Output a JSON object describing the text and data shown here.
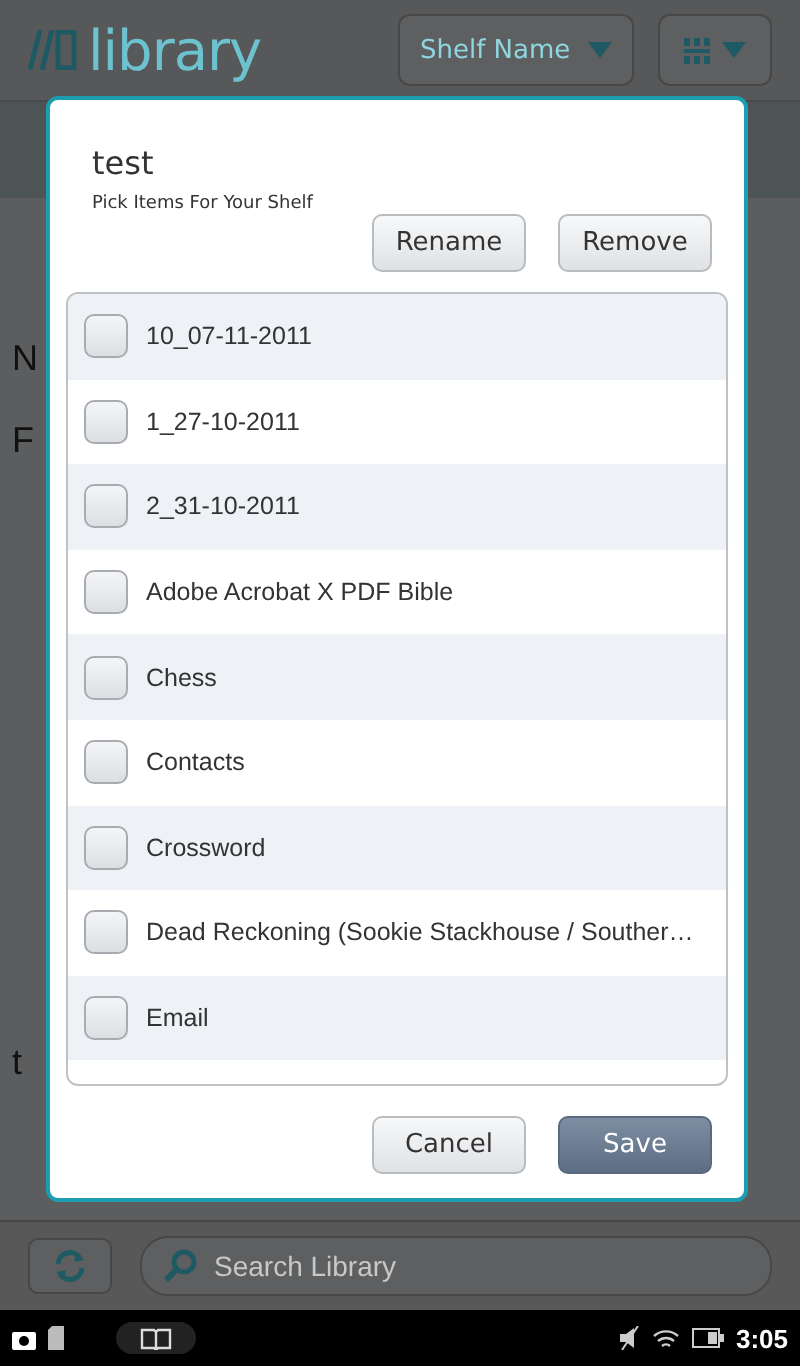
{
  "header": {
    "logo": "library",
    "shelf_menu": "Shelf Name"
  },
  "background_fragments": [
    "N",
    "F",
    "t"
  ],
  "dialog": {
    "title": "test",
    "subtitle": "Pick Items For Your Shelf",
    "top_buttons": [
      "Rename",
      "Remove"
    ],
    "items": [
      {
        "label": "10_07-11-2011",
        "checked": false
      },
      {
        "label": "1_27-10-2011",
        "checked": false
      },
      {
        "label": "2_31-10-2011",
        "checked": false
      },
      {
        "label": "Adobe Acrobat X PDF Bible",
        "checked": false
      },
      {
        "label": "Chess",
        "checked": false
      },
      {
        "label": "Contacts",
        "checked": false
      },
      {
        "label": "Crossword",
        "checked": false
      },
      {
        "label": "Dead Reckoning (Sookie Stackhouse / Souther…",
        "checked": false
      },
      {
        "label": "Email",
        "checked": false
      }
    ],
    "cancel": "Cancel",
    "save": "Save"
  },
  "search": {
    "placeholder": "Search Library"
  },
  "status_bar": {
    "time": "3:05"
  }
}
